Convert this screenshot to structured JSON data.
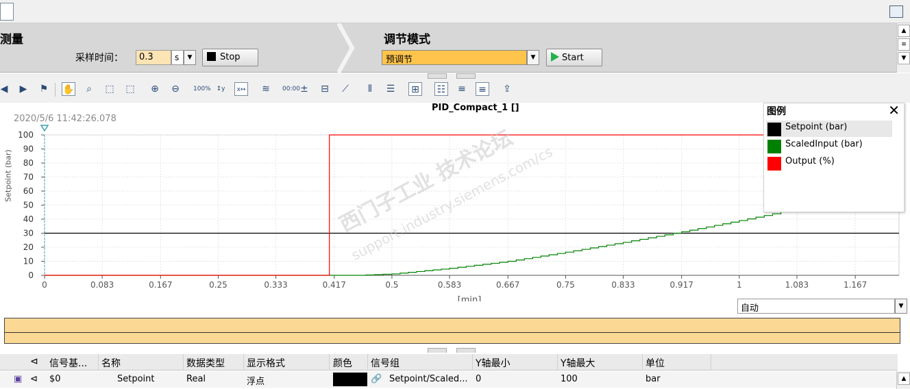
{
  "measure": {
    "title": "测量",
    "sample_time_label": "采样时间：",
    "sample_time_value": "0.3",
    "sample_time_unit": "s",
    "stop_label": "Stop"
  },
  "tuning": {
    "title": "调节模式",
    "mode_value": "预调节",
    "start_label": "Start"
  },
  "chart": {
    "timestamp": "2020/5/6 11:42:26.078",
    "title": "PID_Compact_1 []",
    "y_axis_label_partial": "Setpoint (bar)",
    "x_axis_label": "[min]",
    "scale_mode": "自动",
    "watermark_line1": "西门子工业 技术论坛",
    "watermark_line2": "support.industry.siemens.com/cs"
  },
  "chart_data": {
    "type": "line",
    "title": "PID_Compact_1 []",
    "xlabel": "[min]",
    "ylabel": "Setpoint (bar)",
    "xlim": [
      0,
      1.23
    ],
    "ylim": [
      0,
      100
    ],
    "x_ticks": [
      "0",
      "0.083",
      "0.167",
      "0.25",
      "0.333",
      "0.417",
      "0.5",
      "0.583",
      "0.667",
      "0.75",
      "0.833",
      "0.917",
      "1",
      "1.083",
      "1.167"
    ],
    "y_ticks": [
      "0",
      "10",
      "20",
      "30",
      "40",
      "50",
      "60",
      "70",
      "80",
      "90",
      "100"
    ],
    "grid": true,
    "legend_placement": "top-right",
    "series": [
      {
        "name": "Setpoint (bar)",
        "color": "#000000",
        "x": [
          0,
          1.23
        ],
        "y": [
          30,
          30
        ]
      },
      {
        "name": "ScaledInput (bar)",
        "color": "#008000",
        "x": [
          0,
          0.45,
          0.5,
          0.583,
          0.667,
          0.75,
          0.833,
          0.917,
          1.0,
          1.06
        ],
        "y": [
          0,
          0,
          1,
          5,
          10,
          16.5,
          23.5,
          31,
          39,
          45
        ]
      },
      {
        "name": "Output (%)",
        "color": "#ff0000",
        "x": [
          0,
          0.41,
          0.41,
          1.23
        ],
        "y": [
          0,
          0,
          100,
          100
        ]
      }
    ]
  },
  "legend": {
    "title": "图例",
    "close": "✕",
    "items": [
      {
        "label": "Setpoint (bar)",
        "color": "#000000"
      },
      {
        "label": "ScaledInput (bar)",
        "color": "#008000"
      },
      {
        "label": "Output (%)",
        "color": "#ff0000"
      }
    ]
  },
  "table": {
    "headers": [
      "信号基...",
      "名称",
      "数据类型",
      "显示格式",
      "颜色",
      "信号组",
      "Y轴最小",
      "Y轴最大",
      "单位"
    ],
    "row": {
      "base": "$0",
      "name": "Setpoint",
      "type": "Real",
      "format": "浮点",
      "color": "#000000",
      "group": "Setpoint/Scaled...",
      "ymin": "0",
      "ymax": "100",
      "unit": "bar"
    }
  }
}
